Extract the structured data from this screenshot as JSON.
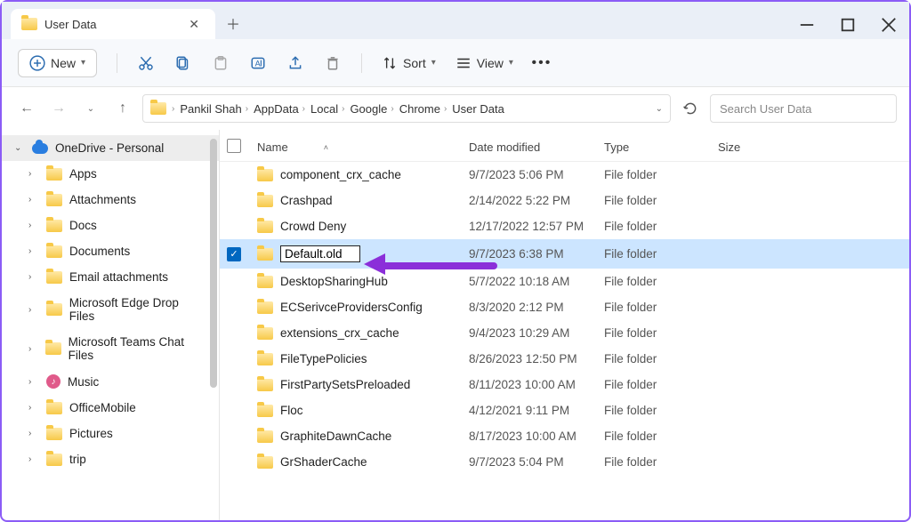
{
  "window": {
    "title": "User Data"
  },
  "toolbar": {
    "new": "New",
    "sort": "Sort",
    "view": "View"
  },
  "breadcrumb": [
    "Pankil Shah",
    "AppData",
    "Local",
    "Google",
    "Chrome",
    "User Data"
  ],
  "search_placeholder": "Search User Data",
  "sidebar": {
    "root": "OneDrive - Personal",
    "items": [
      "Apps",
      "Attachments",
      "Docs",
      "Documents",
      "Email attachments",
      "Microsoft Edge Drop Files",
      "Microsoft Teams Chat Files",
      "Music",
      "OfficeMobile",
      "Pictures",
      "trip"
    ]
  },
  "columns": {
    "name": "Name",
    "date": "Date modified",
    "type": "Type",
    "size": "Size"
  },
  "rows": [
    {
      "name": "component_crx_cache",
      "date": "9/7/2023 5:06 PM",
      "type": "File folder"
    },
    {
      "name": "Crashpad",
      "date": "2/14/2022 5:22 PM",
      "type": "File folder"
    },
    {
      "name": "Crowd Deny",
      "date": "12/17/2022 12:57 PM",
      "type": "File folder"
    },
    {
      "name": "Default.old",
      "date": "9/7/2023 6:38 PM",
      "type": "File folder",
      "selected": true,
      "editing": true
    },
    {
      "name": "DesktopSharingHub",
      "date": "5/7/2022 10:18 AM",
      "type": "File folder"
    },
    {
      "name": "ECSerivceProvidersConfig",
      "date": "8/3/2020 2:12 PM",
      "type": "File folder"
    },
    {
      "name": "extensions_crx_cache",
      "date": "9/4/2023 10:29 AM",
      "type": "File folder"
    },
    {
      "name": "FileTypePolicies",
      "date": "8/26/2023 12:50 PM",
      "type": "File folder"
    },
    {
      "name": "FirstPartySetsPreloaded",
      "date": "8/11/2023 10:00 AM",
      "type": "File folder"
    },
    {
      "name": "Floc",
      "date": "4/12/2021 9:11 PM",
      "type": "File folder"
    },
    {
      "name": "GraphiteDawnCache",
      "date": "8/17/2023 10:00 AM",
      "type": "File folder"
    },
    {
      "name": "GrShaderCache",
      "date": "9/7/2023 5:04 PM",
      "type": "File folder"
    }
  ]
}
